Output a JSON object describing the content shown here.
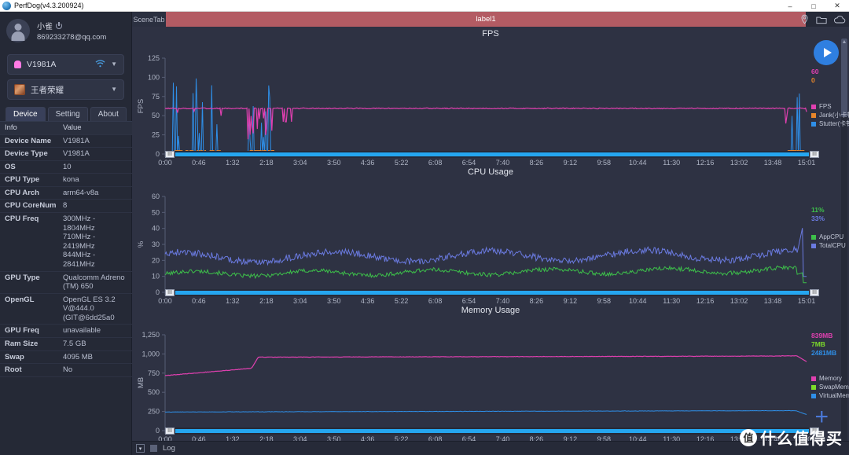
{
  "window": {
    "title": "PerfDog(v4.3.200924)",
    "icon": "perfdog-logo-icon",
    "minimize": "–",
    "maximize": "□",
    "close": "✕"
  },
  "sidebar": {
    "profile": {
      "name": "小雀",
      "email": "869233278@qq.com",
      "power_icon": "power-icon"
    },
    "device_selector": {
      "value": "V1981A",
      "wifi_icon": "wifi-icon",
      "caret": "▼"
    },
    "app_selector": {
      "value": "王者荣耀",
      "caret": "▼"
    },
    "tabs": [
      {
        "label": "Device",
        "active": true
      },
      {
        "label": "Setting",
        "active": false
      },
      {
        "label": "About",
        "active": false
      }
    ],
    "table": {
      "headers": [
        "Info",
        "Value"
      ],
      "rows": [
        {
          "key": "Device Name",
          "value": "V1981A"
        },
        {
          "key": "Device Type",
          "value": "V1981A"
        },
        {
          "key": "OS",
          "value": "10"
        },
        {
          "key": "CPU Type",
          "value": "kona"
        },
        {
          "key": "CPU Arch",
          "value": "arm64-v8a"
        },
        {
          "key": "CPU CoreNum",
          "value": "8"
        },
        {
          "key": "CPU Freq",
          "value": "300MHz - 1804MHz\n710MHz - 2419MHz\n844MHz - 2841MHz"
        },
        {
          "key": "GPU Type",
          "value": "Qualcomm Adreno\n(TM) 650"
        },
        {
          "key": "OpenGL",
          "value": "OpenGL ES 3.2\nV@444.0\n(GIT@6dd25a0"
        },
        {
          "key": "GPU Freq",
          "value": "unavailable"
        },
        {
          "key": "Ram Size",
          "value": "7.5 GB"
        },
        {
          "key": "Swap",
          "value": "4095 MB"
        },
        {
          "key": "Root",
          "value": "No"
        }
      ]
    }
  },
  "main": {
    "scene_tab_label": "SceneTab",
    "scene_label": "label1",
    "top_icons": [
      "location-icon",
      "folder-icon",
      "cloud-icon"
    ],
    "play_button": "play-icon",
    "bottom_bar": {
      "log_label": "Log",
      "expand_icon": "expand-icon"
    }
  },
  "watermark": {
    "badge": "值",
    "text": "什么值得买",
    "plus": "+"
  },
  "chart_data": [
    {
      "id": "fps",
      "type": "line",
      "title": "FPS",
      "ylabel": "FPS",
      "xlabel": "",
      "ylim": [
        0,
        125
      ],
      "yticks": [
        0,
        25,
        50,
        75,
        100,
        125
      ],
      "xticks": [
        "0:00",
        "0:46",
        "1:32",
        "2:18",
        "3:04",
        "3:50",
        "4:36",
        "5:22",
        "6:08",
        "6:54",
        "7:40",
        "8:26",
        "9:12",
        "9:58",
        "10:44",
        "11:30",
        "12:16",
        "13:02",
        "13:48",
        "15:01"
      ],
      "grid": false,
      "legend_position": "right",
      "legend": [
        {
          "name": "FPS",
          "color": "#e040b0"
        },
        {
          "name": "Jank(小卡顿)",
          "color": "#e8862a"
        },
        {
          "name": "Stutter(卡顿率)",
          "color": "#2f8fe8"
        }
      ],
      "value_tags": [
        {
          "label": "60",
          "color": "#e040b0"
        },
        {
          "label": "0",
          "color": "#e8862a"
        }
      ],
      "series": [
        {
          "name": "FPS",
          "color": "#e040b0",
          "baseline": 60,
          "note": "flat ~60 fps with dips to 40-55 in first 1:30 and near 2:05-2:20"
        },
        {
          "name": "Stutter",
          "color": "#2f8fe8",
          "color2": "#2f8fe8",
          "note": "spikes to 25-100 clustered 0:10-1:10 and 2:00-2:25 and near 14:40"
        }
      ]
    },
    {
      "id": "cpu",
      "type": "line",
      "title": "CPU Usage",
      "ylabel": "%",
      "xlabel": "",
      "ylim": [
        0,
        60
      ],
      "yticks": [
        0,
        10,
        20,
        30,
        40,
        50,
        60
      ],
      "xticks": [
        "0:00",
        "0:46",
        "1:32",
        "2:18",
        "3:04",
        "3:50",
        "4:36",
        "5:22",
        "6:08",
        "6:54",
        "7:40",
        "8:26",
        "9:12",
        "9:58",
        "10:44",
        "11:30",
        "12:16",
        "13:02",
        "13:48",
        "15:01"
      ],
      "grid": false,
      "legend_position": "right",
      "legend": [
        {
          "name": "AppCPU",
          "color": "#3dc04a"
        },
        {
          "name": "TotalCPU",
          "color": "#6a7ae0"
        }
      ],
      "value_tags": [
        {
          "label": "11%",
          "color": "#3dc04a"
        },
        {
          "label": "33%",
          "color": "#6a7ae0"
        }
      ],
      "series": [
        {
          "name": "AppCPU",
          "color": "#3dc04a",
          "mean": 13,
          "note": "hovers 10-16%"
        },
        {
          "name": "TotalCPU",
          "color": "#6a7ae0",
          "mean": 25,
          "note": "hovers 20-32%, final spike to ~52%"
        }
      ]
    },
    {
      "id": "memory",
      "type": "line",
      "title": "Memory Usage",
      "ylabel": "MB",
      "xlabel": "",
      "ylim": [
        0,
        1250
      ],
      "yticks": [
        0,
        250,
        500,
        750,
        1000,
        1250
      ],
      "ytick_labels": [
        "0",
        "250",
        "500",
        "750",
        "1,000",
        "1,250"
      ],
      "xticks": [
        "0:00",
        "0:46",
        "1:32",
        "2:18",
        "3:04",
        "3:50",
        "4:36",
        "5:22",
        "6:08",
        "6:54",
        "7:40",
        "8:26",
        "9:12",
        "9:58",
        "10:44",
        "11:30",
        "12:16",
        "13:02",
        "13:48",
        "15:01"
      ],
      "grid": false,
      "legend_position": "right",
      "legend": [
        {
          "name": "Memory",
          "color": "#e040b0"
        },
        {
          "name": "SwapMemory",
          "color": "#7ddb2a"
        },
        {
          "name": "VirtualMemory",
          "color": "#2f8fe8"
        }
      ],
      "value_tags": [
        {
          "label": "839MB",
          "color": "#e040b0"
        },
        {
          "label": "7MB",
          "color": "#7ddb2a"
        },
        {
          "label": "2481MB",
          "color": "#2f8fe8"
        }
      ],
      "series": [
        {
          "name": "Memory",
          "color": "#e040b0",
          "start": 720,
          "end": 975,
          "note": "rises 720 -> 830, step at 2:05 to 960, plateau ~965, dip at end to 900"
        },
        {
          "name": "SwapMemory",
          "color": "#7ddb2a",
          "start": 5,
          "end": 7,
          "note": "flat near 0-10 MB"
        },
        {
          "name": "VirtualMemory",
          "color": "#2f8fe8",
          "start": 240,
          "end": 255,
          "note": "flat ~245-255 MB (scaled)"
        }
      ]
    }
  ]
}
